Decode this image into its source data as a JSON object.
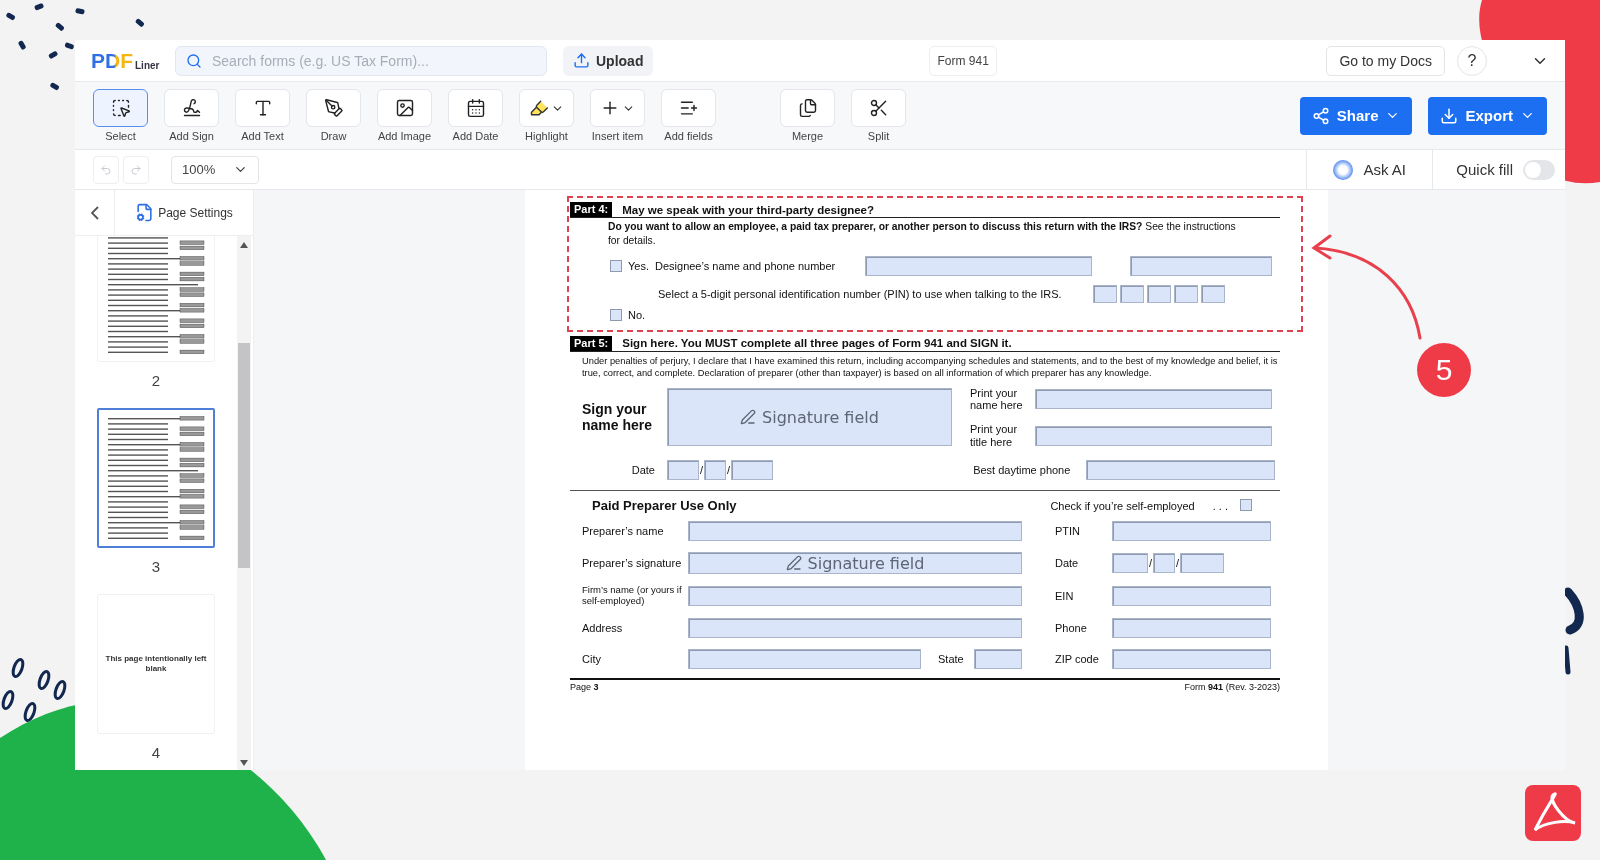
{
  "header": {
    "logo": {
      "main": "PDF",
      "sub": "Liner"
    },
    "search": {
      "placeholder": "Search forms (e.g. US Tax Form)..."
    },
    "upload": "Upload",
    "document_title": "Form 941",
    "docs_button": "Go to my Docs",
    "help": "?"
  },
  "tool_groups": [
    [
      {
        "label": "Select",
        "selected": true,
        "menu": false
      },
      {
        "label": "Add Sign",
        "selected": false,
        "menu": false
      },
      {
        "label": "Add Text",
        "selected": false,
        "menu": false
      },
      {
        "label": "Draw",
        "selected": false,
        "menu": false
      },
      {
        "label": "Add Image",
        "selected": false,
        "menu": false
      },
      {
        "label": "Add Date",
        "selected": false,
        "menu": false
      },
      {
        "label": "Highlight",
        "selected": false,
        "menu": true
      },
      {
        "label": "Insert item",
        "selected": false,
        "menu": true
      },
      {
        "label": "Add fields",
        "selected": false,
        "menu": false
      }
    ],
    [
      {
        "label": "Merge",
        "selected": false,
        "menu": false
      },
      {
        "label": "Split",
        "selected": false,
        "menu": false
      }
    ]
  ],
  "actions": [
    "Share",
    "Export"
  ],
  "zoom": "100%",
  "ask_ai": "Ask AI",
  "quick_fill": {
    "label": "Quick fill",
    "on": false
  },
  "sidebar": {
    "title": "Page Settings",
    "pages": [
      {
        "number": "2",
        "kind": "form",
        "selected": false
      },
      {
        "number": "3",
        "kind": "form",
        "selected": true
      },
      {
        "number": "4",
        "kind": "blank",
        "selected": false,
        "text": "This page intentionally left blank"
      }
    ]
  },
  "form": {
    "part4": {
      "highlighted": true,
      "tag": "Part 4:",
      "title": "May we speak with your third-party designee?",
      "question": "**Do you want to allow an employee, a paid tax preparer, or another person to discuss this return with the IRS?** See the instructions for details.",
      "yes": {
        "label": "Yes.",
        "checked": false
      },
      "designee_label": "Designee’s name and phone number",
      "pin_label": "Select a 5-digit personal identification number (PIN) to use when talking to the IRS.",
      "no": {
        "label": "No.",
        "checked": false
      }
    },
    "part5": {
      "tag": "Part 5:",
      "title": "Sign here. You MUST complete all three pages of Form 941 and SIGN it.",
      "declaration": "Under penalties of perjury, I declare that I have examined this return, including accompanying schedules and statements, and to the best of my knowledge and belief, it is true, correct, and complete. Declaration of preparer (other than taxpayer) is based on all information of which preparer has any knowledge.",
      "sign_label": "Sign your name here",
      "signature": "Signature field",
      "print_name": "Print your name here",
      "print_title": "Print your title here",
      "date_label": "Date",
      "date_separators": [
        "/",
        "/"
      ],
      "phone_label": "Best daytime phone"
    },
    "preparer": {
      "title": "Paid Preparer Use Only",
      "self_employed": {
        "label": "Check if you’re self-employed",
        "dots": ". . .",
        "checked": false
      },
      "rows": [
        {
          "label": "Preparer’s name",
          "kind": "text",
          "right": {
            "label": "PTIN",
            "kind": "text"
          }
        },
        {
          "label": "Preparer’s signature",
          "kind": "signature",
          "text": "Signature field",
          "right": {
            "label": "Date",
            "kind": "date",
            "separators": [
              "/",
              "/"
            ]
          }
        },
        {
          "label": "Firm’s name (or yours if self-employed)",
          "kind": "text",
          "right": {
            "label": "EIN",
            "kind": "text"
          }
        },
        {
          "label": "Address",
          "kind": "text",
          "right": {
            "label": "Phone",
            "kind": "text"
          }
        },
        {
          "label": "City",
          "kind": "city",
          "state_label": "State",
          "right": {
            "label": "ZIP code",
            "kind": "text"
          }
        }
      ]
    },
    "footer": {
      "page": "Page **3**",
      "form": "Form **941** (Rev. 3-2023)"
    }
  },
  "callout": {
    "number": "5"
  }
}
